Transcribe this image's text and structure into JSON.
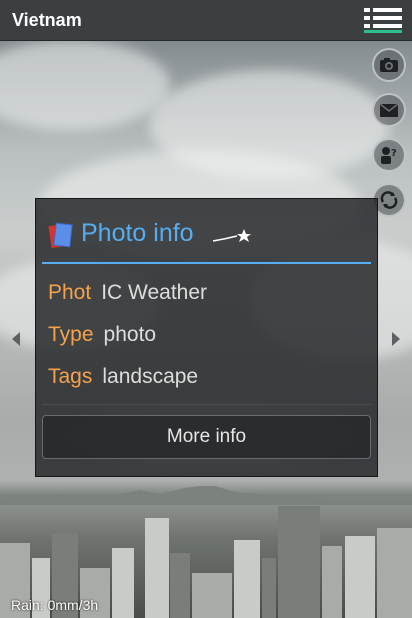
{
  "app": {
    "title": "Vietnam"
  },
  "menu": {
    "icon": "menu-icon"
  },
  "side_buttons": [
    {
      "name": "camera-button",
      "icon": "camera-icon"
    },
    {
      "name": "mail-button",
      "icon": "mail-icon"
    },
    {
      "name": "help-button",
      "icon": "help-icon"
    },
    {
      "name": "refresh-button",
      "icon": "refresh-icon"
    }
  ],
  "popup": {
    "title": "Photo info",
    "rows": [
      {
        "key": "Phot",
        "value": "IC Weather"
      },
      {
        "key": "Type",
        "value": "photo"
      },
      {
        "key": "Tags",
        "value": "landscape"
      }
    ],
    "more_button": "More info"
  },
  "status": {
    "rain": "Rain: 0mm/3h"
  },
  "colors": {
    "accent_blue": "#55aef2",
    "key_orange": "#f5a24a",
    "menu_green": "#2fbf8a",
    "topbar": "#3b3f42"
  }
}
